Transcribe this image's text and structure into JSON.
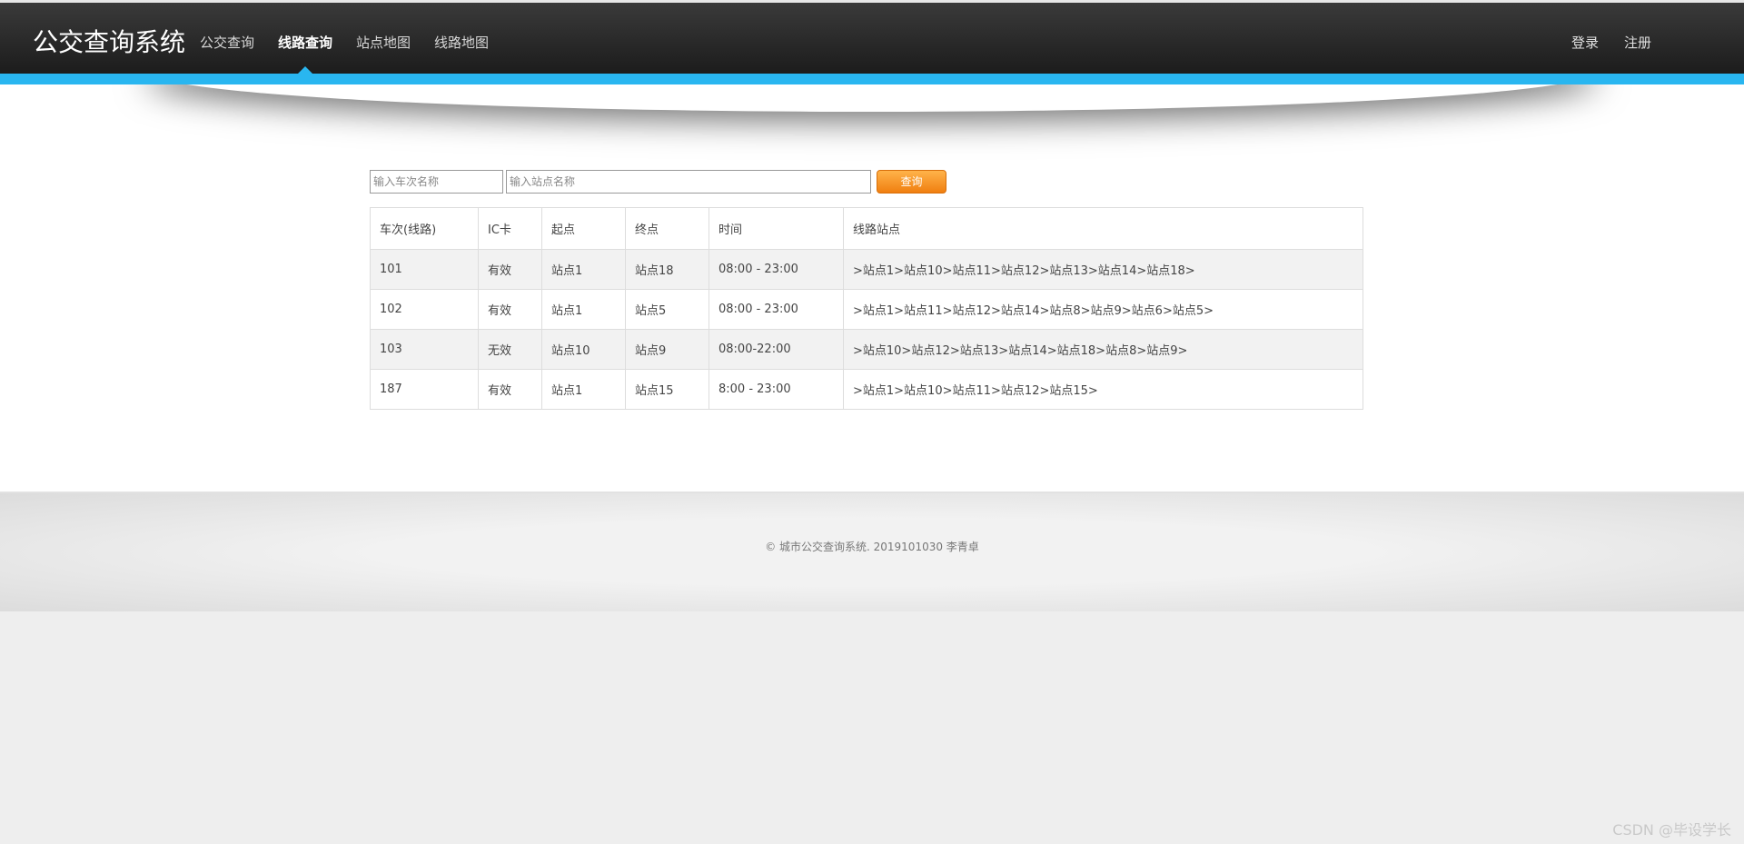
{
  "header": {
    "brand": "公交查询系统",
    "nav": [
      {
        "label": "公交查询"
      },
      {
        "label": "线路查询"
      },
      {
        "label": "站点地图"
      },
      {
        "label": "线路地图"
      }
    ],
    "active_index": 1,
    "login_label": "登录",
    "register_label": "注册",
    "accent_color": "#29b6f0"
  },
  "search": {
    "route_placeholder": "输入车次名称",
    "station_placeholder": "输入站点名称",
    "button_label": "查询",
    "button_color": "#f5921e"
  },
  "table": {
    "columns": [
      "车次(线路)",
      "IC卡",
      "起点",
      "终点",
      "时间",
      "线路站点"
    ],
    "rows": [
      [
        "101",
        "有效",
        "站点1",
        "站点18",
        "08:00 - 23:00",
        ">站点1>站点10>站点11>站点12>站点13>站点14>站点18>"
      ],
      [
        "102",
        "有效",
        "站点1",
        "站点5",
        "08:00 - 23:00",
        ">站点1>站点11>站点12>站点14>站点8>站点9>站点6>站点5>"
      ],
      [
        "103",
        "无效",
        "站点10",
        "站点9",
        "08:00-22:00",
        ">站点10>站点12>站点13>站点14>站点18>站点8>站点9>"
      ],
      [
        "187",
        "有效",
        "站点1",
        "站点15",
        "8:00 - 23:00",
        ">站点1>站点10>站点11>站点12>站点15>"
      ]
    ]
  },
  "footer": {
    "copyright": "© 城市公交查询系统. 2019101030 李青卓"
  },
  "watermark": "CSDN @毕设学长"
}
